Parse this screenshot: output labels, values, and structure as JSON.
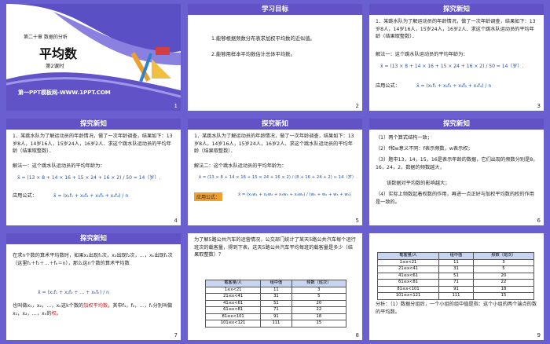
{
  "slides": [
    {
      "id": 1,
      "num": "1",
      "chapter": "第二十章 数据的分析",
      "title": "平均数",
      "subtitle": "第2课时",
      "footer": "第一PPT模板网-WWW.1PPT.COM"
    },
    {
      "id": 2,
      "num": "2",
      "header": "学习目标",
      "lines": [
        "1.能够根据频数分布表求加权平均数的近似值。",
        "2.能够用样本平均数估计总体平均数。"
      ]
    },
    {
      "id": 3,
      "num": "3",
      "header": "探究新知",
      "problem": "1．某跳水队为了解运动员的年龄情况，做了一次年龄调查，结果如下：13岁8人，14岁16人，15岁24人，16岁2人．求这个跳水队运动员的平均年龄（结果取整数）．",
      "solution": "解法一：这个跳水队运动员的平均年龄为：",
      "formula1": "x̄ = (13 × 8 + 14 × 16 + 15 × 24 + 16 × 2) / 50 ≈ 14（岁）.",
      "apply_label": "应用公式：",
      "formula2": "x̄ = (x₁f₁ + x₂f₂ + x₃f₃ + x₄f₄) / n"
    },
    {
      "id": 4,
      "num": "4",
      "header": "探究新知"
    },
    {
      "id": 5,
      "num": "5",
      "header": "探究新知",
      "solution2": "解法二：这个跳水队运动员的平均年龄为：",
      "formula3": "x̄ = (13 × 8 + 14 × 16 + 15 × 24 + 16 × 2) / (8 + 16 + 24 + 2) ≈ 14（岁）.",
      "formula4": "x̄ = (x₁w₁ + x₂w₂ + x₃w₃ + x₄w₄) / (w₁ + w₂ + w₃ + w₄)"
    },
    {
      "id": 6,
      "num": "6",
      "header": "探究新知",
      "lines": [
        "（1）两个算式结构一致；",
        "（2）f和w意义不同：f表示频数，w表示权；",
        "（3）题中13，14，15，16是表示年龄的数据，它们出现的频数分别是8，16，24，2，数据的频数越大，",
        "该数据对平均数的影响越大；",
        "（4）实际上频数起着权数的作用，再进一点正好与加权平均数的权的作用是一致的。"
      ]
    },
    {
      "id": 7,
      "num": "7",
      "header": "探究新知",
      "lines": [
        "在求n个数的算术平均数时，如果x₁出现f₁次，x₂出现f₂次，…，xₖ出现fₖ次（这里f₁＋f₂＋…＋fₖ＝n），那么这n个数的算术平均数",
        "x̄ = (x₁f₁ + x₂f₂ + … + xₖfₖ) / n",
        "也叫做x₁，x₂，…，xₖ这k个数的",
        "加权平均数",
        "，其中f₁，f₂，…，fₖ分别叫做x₁，x₂，…，xₖ的",
        "权",
        "。"
      ]
    },
    {
      "id": 8,
      "num": "8",
      "intro": "为了解5路公共汽车的运营情况，公交部门统计了某天5路公共汽车每个运行班次的载客量，得到下表，这天5路公共汽车平均每班的载客量是多少（结果取整数）？",
      "table": {
        "headers": [
          "载客量/人",
          "组中值",
          "频数（班次）"
        ],
        "rows": [
          [
            "1≤x<21",
            "11",
            "3"
          ],
          [
            "21≤x<41",
            "31",
            "5"
          ],
          [
            "41≤x<61",
            "51",
            "20"
          ],
          [
            "61≤x<81",
            "71",
            "22"
          ],
          [
            "81≤x<101",
            "91",
            "18"
          ],
          [
            "101≤x<121",
            "111",
            "15"
          ]
        ]
      }
    },
    {
      "id": 9,
      "num": "9",
      "table": {
        "headers": [
          "载客量/人",
          "组中值",
          "频数（班次）"
        ],
        "rows": [
          [
            "1≤x<21",
            "11",
            "3"
          ],
          [
            "21≤x<41",
            "31",
            "5"
          ],
          [
            "41≤x<61",
            "51",
            "20"
          ],
          [
            "61≤x<81",
            "71",
            "22"
          ],
          [
            "81≤x<101",
            "91",
            "18"
          ],
          [
            "101≤x<121",
            "111",
            "15"
          ]
        ]
      },
      "analysis": "分析：（1）数据分组后，一个小组的组中值是指：这个小组的两个端点的数的平均数。"
    }
  ]
}
